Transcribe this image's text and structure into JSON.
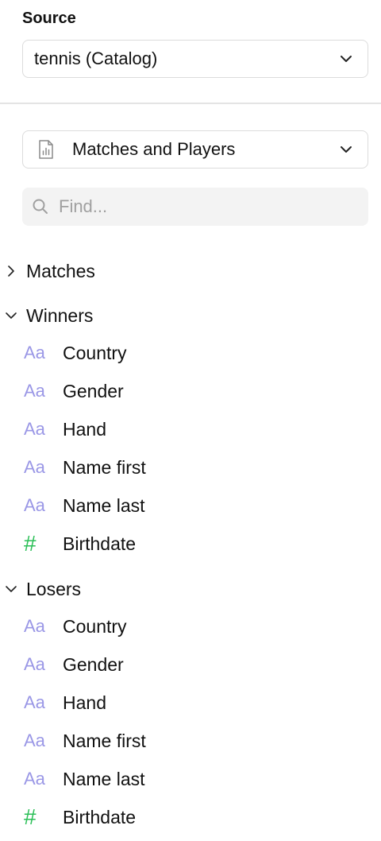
{
  "source": {
    "label": "Source",
    "selected": "tennis (Catalog)"
  },
  "model": {
    "selected": "Matches and Players"
  },
  "search": {
    "placeholder": "Find..."
  },
  "groups": [
    {
      "label": "Matches",
      "expanded": false,
      "fields": []
    },
    {
      "label": "Winners",
      "expanded": true,
      "fields": [
        {
          "icon": "Aa",
          "type": "text",
          "label": "Country"
        },
        {
          "icon": "Aa",
          "type": "text",
          "label": "Gender"
        },
        {
          "icon": "Aa",
          "type": "text",
          "label": "Hand"
        },
        {
          "icon": "Aa",
          "type": "text",
          "label": "Name first"
        },
        {
          "icon": "Aa",
          "type": "text",
          "label": "Name last"
        },
        {
          "icon": "#",
          "type": "number",
          "label": "Birthdate"
        }
      ]
    },
    {
      "label": "Losers",
      "expanded": true,
      "fields": [
        {
          "icon": "Aa",
          "type": "text",
          "label": "Country"
        },
        {
          "icon": "Aa",
          "type": "text",
          "label": "Gender"
        },
        {
          "icon": "Aa",
          "type": "text",
          "label": "Hand"
        },
        {
          "icon": "Aa",
          "type": "text",
          "label": "Name first"
        },
        {
          "icon": "Aa",
          "type": "text",
          "label": "Name last"
        },
        {
          "icon": "#",
          "type": "number",
          "label": "Birthdate"
        }
      ]
    }
  ],
  "colors": {
    "text_field_icon": "#9a97e6",
    "number_field_icon": "#2bbf57"
  }
}
